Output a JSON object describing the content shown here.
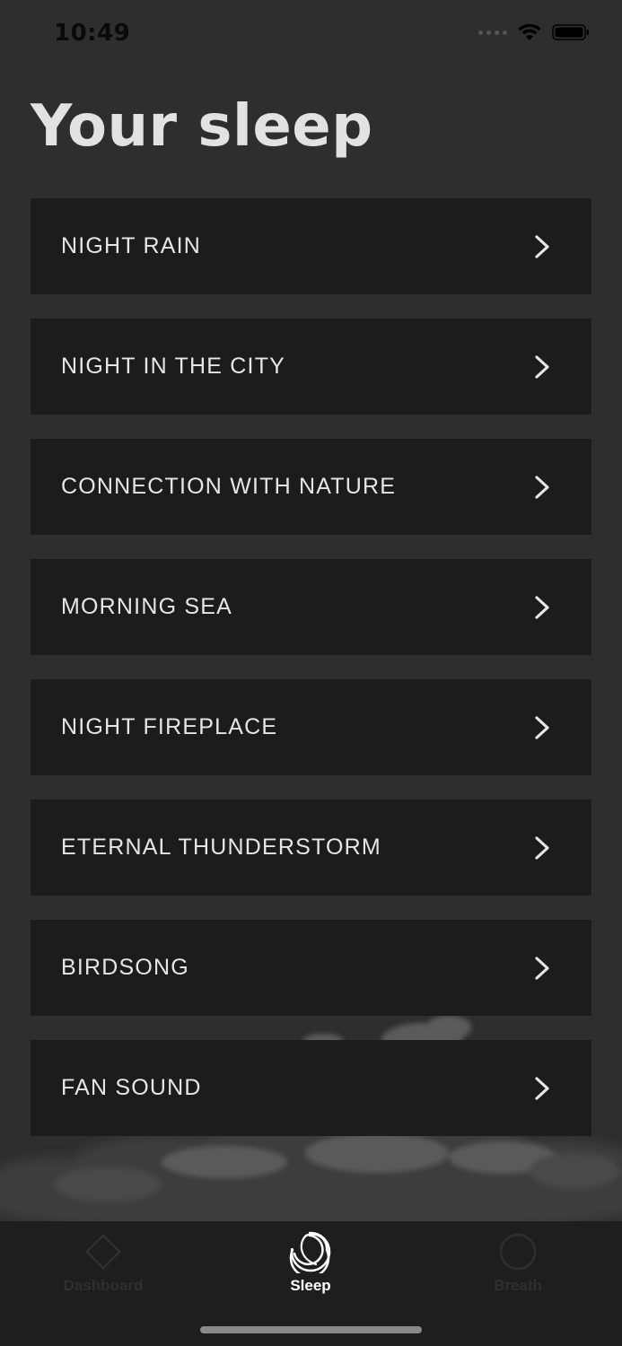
{
  "status_bar": {
    "time": "10:49",
    "wifi_icon": "wifi-icon",
    "battery_icon": "battery-icon"
  },
  "page": {
    "title": "Your sleep"
  },
  "sounds": [
    {
      "label": "NIGHT RAIN",
      "icon": "chevron-right-icon"
    },
    {
      "label": "NIGHT IN THE CITY",
      "icon": "chevron-right-icon"
    },
    {
      "label": "CONNECTION WITH NATURE",
      "icon": "chevron-right-icon"
    },
    {
      "label": "MORNING SEA",
      "icon": "chevron-right-icon"
    },
    {
      "label": "NIGHT FIREPLACE",
      "icon": "chevron-right-icon"
    },
    {
      "label": "ETERNAL THUNDERSTORM",
      "icon": "chevron-right-icon"
    },
    {
      "label": "BIRDSONG",
      "icon": "chevron-right-icon"
    },
    {
      "label": "FAN SOUND",
      "icon": "chevron-right-icon"
    }
  ],
  "tab_bar": {
    "tabs": [
      {
        "label": "Dashboard",
        "icon": "diamond-icon",
        "active": false
      },
      {
        "label": "Sleep",
        "icon": "moon-icon",
        "active": true
      },
      {
        "label": "Breath",
        "icon": "circle-icon",
        "active": false
      }
    ]
  },
  "colors": {
    "background": "#2e2e2e",
    "card": "#1c1c1c",
    "text": "#e6e6e6",
    "tab_active": "#ffffff",
    "tab_inactive": "#2f2f2f"
  }
}
